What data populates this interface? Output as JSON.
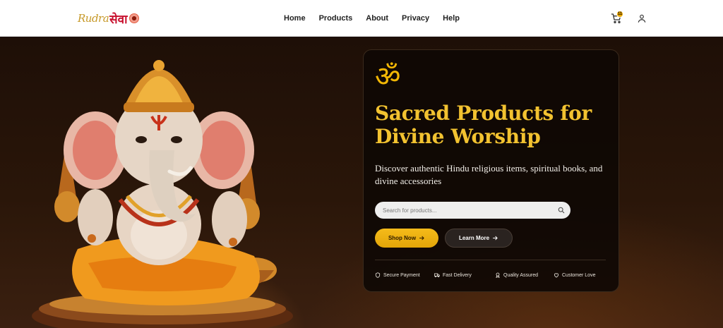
{
  "brand": {
    "logo_latin": "Rudra",
    "logo_devanagari": "सेवा"
  },
  "nav": {
    "items": [
      {
        "label": "Home"
      },
      {
        "label": "Products"
      },
      {
        "label": "About"
      },
      {
        "label": "Privacy"
      },
      {
        "label": "Help"
      }
    ]
  },
  "header_actions": {
    "cart_count": "11",
    "cart_icon": "cart-icon",
    "user_icon": "user-icon"
  },
  "hero": {
    "symbol": "ॐ",
    "title_line1": "Sacred Products for",
    "title_line2": "Divine Worship",
    "subtitle": "Discover authentic Hindu religious items, spiritual books, and divine accessories",
    "search": {
      "placeholder": "Search for products..."
    },
    "primary_button": "Shop Now",
    "secondary_button": "Learn More",
    "features": [
      {
        "label": "Secure Payment",
        "icon": "shield-icon"
      },
      {
        "label": "Fast Delivery",
        "icon": "truck-icon"
      },
      {
        "label": "Quality Assured",
        "icon": "award-icon"
      },
      {
        "label": "Customer Love",
        "icon": "heart-icon"
      }
    ]
  },
  "colors": {
    "accent": "#f2c230",
    "button_gold": "#eab010",
    "header_bg": "#ffffff",
    "hero_bg": "#1e0f07"
  }
}
